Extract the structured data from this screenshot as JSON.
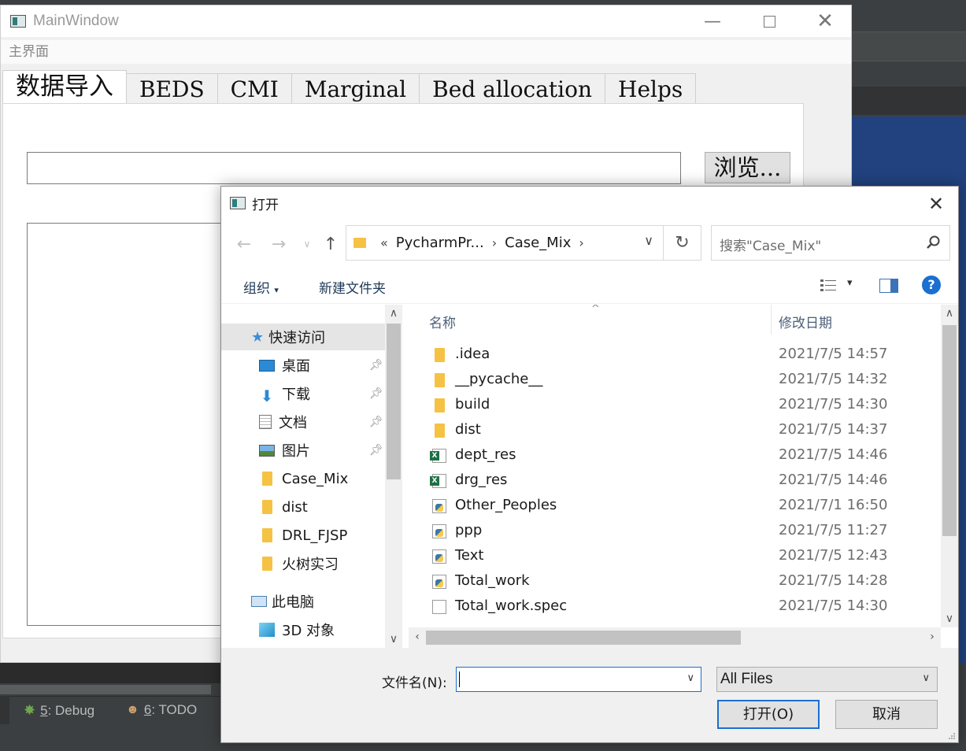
{
  "main_window": {
    "title": "MainWindow",
    "menu": "主界面",
    "tabs": [
      "数据导入",
      "BEDS",
      "CMI",
      "Marginal",
      "Bed allocation",
      "Helps"
    ],
    "browse_label": "浏览...",
    "path_value": ""
  },
  "ide": {
    "debug_num": "5",
    "debug_label": ": Debug",
    "todo_num": "6",
    "todo_label": ": TODO"
  },
  "dialog": {
    "title": "打开",
    "breadcrumb_prefix": "«",
    "breadcrumb": [
      "PycharmPr...",
      "Case_Mix"
    ],
    "search_placeholder": "搜索\"Case_Mix\"",
    "organize": "组织",
    "new_folder": "新建文件夹",
    "nav": {
      "quick_access": "快速访问",
      "pinned": [
        {
          "label": "桌面",
          "icon": "desktop-icon"
        },
        {
          "label": "下载",
          "icon": "download-icon"
        },
        {
          "label": "文档",
          "icon": "documents-icon"
        },
        {
          "label": "图片",
          "icon": "pictures-icon"
        }
      ],
      "folders": [
        "Case_Mix",
        "dist",
        "DRL_FJSP",
        "火树实习"
      ],
      "this_pc": "此电脑",
      "objects_3d": "3D 对象"
    },
    "columns": {
      "name": "名称",
      "modified": "修改日期"
    },
    "files": [
      {
        "name": ".idea",
        "date": "2021/7/5 14:57",
        "type": "folder"
      },
      {
        "name": "__pycache__",
        "date": "2021/7/5 14:32",
        "type": "folder"
      },
      {
        "name": "build",
        "date": "2021/7/5 14:30",
        "type": "folder"
      },
      {
        "name": "dist",
        "date": "2021/7/5 14:37",
        "type": "folder"
      },
      {
        "name": "dept_res",
        "date": "2021/7/5 14:46",
        "type": "xls"
      },
      {
        "name": "drg_res",
        "date": "2021/7/5 14:46",
        "type": "xls"
      },
      {
        "name": "Other_Peoples",
        "date": "2021/7/1 16:50",
        "type": "py"
      },
      {
        "name": "ppp",
        "date": "2021/7/5 11:27",
        "type": "py"
      },
      {
        "name": "Text",
        "date": "2021/7/5 12:43",
        "type": "py"
      },
      {
        "name": "Total_work",
        "date": "2021/7/5 14:28",
        "type": "py"
      },
      {
        "name": "Total_work.spec",
        "date": "2021/7/5 14:30",
        "type": "doc"
      }
    ],
    "filename_label": "文件名(N):",
    "filename_value": "",
    "filter_value": "All Files",
    "open_label": "打开(O)",
    "cancel_label": "取消"
  }
}
